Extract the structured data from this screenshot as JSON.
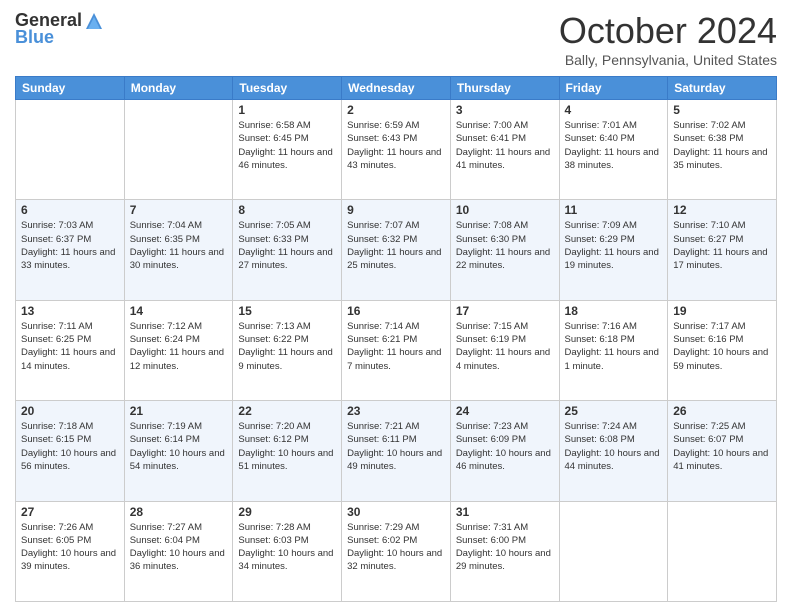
{
  "header": {
    "logo_general": "General",
    "logo_blue": "Blue",
    "month": "October 2024",
    "location": "Bally, Pennsylvania, United States"
  },
  "days_of_week": [
    "Sunday",
    "Monday",
    "Tuesday",
    "Wednesday",
    "Thursday",
    "Friday",
    "Saturday"
  ],
  "weeks": [
    [
      {
        "day": "",
        "info": ""
      },
      {
        "day": "",
        "info": ""
      },
      {
        "day": "1",
        "info": "Sunrise: 6:58 AM\nSunset: 6:45 PM\nDaylight: 11 hours and 46 minutes."
      },
      {
        "day": "2",
        "info": "Sunrise: 6:59 AM\nSunset: 6:43 PM\nDaylight: 11 hours and 43 minutes."
      },
      {
        "day": "3",
        "info": "Sunrise: 7:00 AM\nSunset: 6:41 PM\nDaylight: 11 hours and 41 minutes."
      },
      {
        "day": "4",
        "info": "Sunrise: 7:01 AM\nSunset: 6:40 PM\nDaylight: 11 hours and 38 minutes."
      },
      {
        "day": "5",
        "info": "Sunrise: 7:02 AM\nSunset: 6:38 PM\nDaylight: 11 hours and 35 minutes."
      }
    ],
    [
      {
        "day": "6",
        "info": "Sunrise: 7:03 AM\nSunset: 6:37 PM\nDaylight: 11 hours and 33 minutes."
      },
      {
        "day": "7",
        "info": "Sunrise: 7:04 AM\nSunset: 6:35 PM\nDaylight: 11 hours and 30 minutes."
      },
      {
        "day": "8",
        "info": "Sunrise: 7:05 AM\nSunset: 6:33 PM\nDaylight: 11 hours and 27 minutes."
      },
      {
        "day": "9",
        "info": "Sunrise: 7:07 AM\nSunset: 6:32 PM\nDaylight: 11 hours and 25 minutes."
      },
      {
        "day": "10",
        "info": "Sunrise: 7:08 AM\nSunset: 6:30 PM\nDaylight: 11 hours and 22 minutes."
      },
      {
        "day": "11",
        "info": "Sunrise: 7:09 AM\nSunset: 6:29 PM\nDaylight: 11 hours and 19 minutes."
      },
      {
        "day": "12",
        "info": "Sunrise: 7:10 AM\nSunset: 6:27 PM\nDaylight: 11 hours and 17 minutes."
      }
    ],
    [
      {
        "day": "13",
        "info": "Sunrise: 7:11 AM\nSunset: 6:25 PM\nDaylight: 11 hours and 14 minutes."
      },
      {
        "day": "14",
        "info": "Sunrise: 7:12 AM\nSunset: 6:24 PM\nDaylight: 11 hours and 12 minutes."
      },
      {
        "day": "15",
        "info": "Sunrise: 7:13 AM\nSunset: 6:22 PM\nDaylight: 11 hours and 9 minutes."
      },
      {
        "day": "16",
        "info": "Sunrise: 7:14 AM\nSunset: 6:21 PM\nDaylight: 11 hours and 7 minutes."
      },
      {
        "day": "17",
        "info": "Sunrise: 7:15 AM\nSunset: 6:19 PM\nDaylight: 11 hours and 4 minutes."
      },
      {
        "day": "18",
        "info": "Sunrise: 7:16 AM\nSunset: 6:18 PM\nDaylight: 11 hours and 1 minute."
      },
      {
        "day": "19",
        "info": "Sunrise: 7:17 AM\nSunset: 6:16 PM\nDaylight: 10 hours and 59 minutes."
      }
    ],
    [
      {
        "day": "20",
        "info": "Sunrise: 7:18 AM\nSunset: 6:15 PM\nDaylight: 10 hours and 56 minutes."
      },
      {
        "day": "21",
        "info": "Sunrise: 7:19 AM\nSunset: 6:14 PM\nDaylight: 10 hours and 54 minutes."
      },
      {
        "day": "22",
        "info": "Sunrise: 7:20 AM\nSunset: 6:12 PM\nDaylight: 10 hours and 51 minutes."
      },
      {
        "day": "23",
        "info": "Sunrise: 7:21 AM\nSunset: 6:11 PM\nDaylight: 10 hours and 49 minutes."
      },
      {
        "day": "24",
        "info": "Sunrise: 7:23 AM\nSunset: 6:09 PM\nDaylight: 10 hours and 46 minutes."
      },
      {
        "day": "25",
        "info": "Sunrise: 7:24 AM\nSunset: 6:08 PM\nDaylight: 10 hours and 44 minutes."
      },
      {
        "day": "26",
        "info": "Sunrise: 7:25 AM\nSunset: 6:07 PM\nDaylight: 10 hours and 41 minutes."
      }
    ],
    [
      {
        "day": "27",
        "info": "Sunrise: 7:26 AM\nSunset: 6:05 PM\nDaylight: 10 hours and 39 minutes."
      },
      {
        "day": "28",
        "info": "Sunrise: 7:27 AM\nSunset: 6:04 PM\nDaylight: 10 hours and 36 minutes."
      },
      {
        "day": "29",
        "info": "Sunrise: 7:28 AM\nSunset: 6:03 PM\nDaylight: 10 hours and 34 minutes."
      },
      {
        "day": "30",
        "info": "Sunrise: 7:29 AM\nSunset: 6:02 PM\nDaylight: 10 hours and 32 minutes."
      },
      {
        "day": "31",
        "info": "Sunrise: 7:31 AM\nSunset: 6:00 PM\nDaylight: 10 hours and 29 minutes."
      },
      {
        "day": "",
        "info": ""
      },
      {
        "day": "",
        "info": ""
      }
    ]
  ]
}
